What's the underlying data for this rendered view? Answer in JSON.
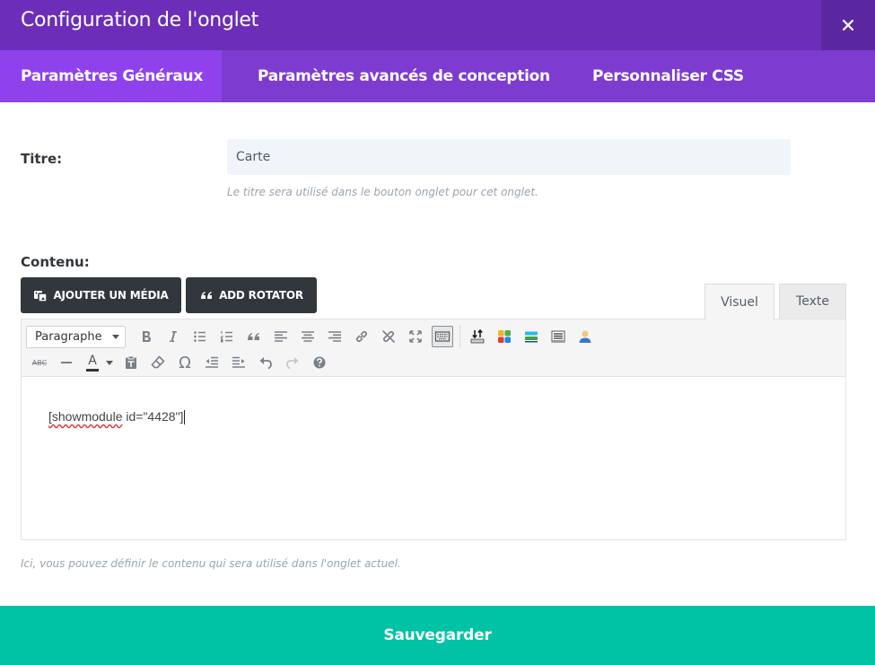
{
  "header": {
    "title": "Configuration de l'onglet",
    "close_icon": "close-icon",
    "bg_color": "#6c2eb9"
  },
  "tabs": [
    {
      "label": "Paramètres Généraux",
      "active": true
    },
    {
      "label": "Paramètres avancés de conception",
      "active": false
    },
    {
      "label": "Personnaliser CSS",
      "active": false
    }
  ],
  "title_field": {
    "label": "Titre:",
    "value": "Carte",
    "hint": "Le titre sera utilisé dans le bouton onglet pour cet onglet."
  },
  "content_field": {
    "label": "Contenu:",
    "hint": "Ici, vous pouvez définir le contenu qui sera utilisé dans l'onglet actuel.",
    "buttons": {
      "media": "AJOUTER UN MÉDIA",
      "rotator": "ADD ROTATOR"
    },
    "editor_tabs": {
      "visual": "Visuel",
      "text": "Texte",
      "active": "visual"
    },
    "toolbar": {
      "format_select": "Paragraphe",
      "row1_icons": [
        "bold-icon",
        "italic-icon",
        "bullet-list-icon",
        "numbered-list-icon",
        "blockquote-icon",
        "align-left-icon",
        "align-center-icon",
        "align-right-icon",
        "link-icon",
        "unlink-icon",
        "fullscreen-icon",
        "toolbar-toggle-icon",
        "upload-icon",
        "modules-icon",
        "layers-icon",
        "list-icon",
        "user-icon"
      ],
      "row2_icons": [
        "strikethrough-icon",
        "horizontal-line-icon",
        "text-color-icon",
        "paste-text-icon",
        "clear-format-icon",
        "special-char-icon",
        "outdent-icon",
        "indent-icon",
        "undo-icon",
        "redo-icon",
        "help-icon"
      ],
      "strikethrough_glyph": "ABC",
      "text_color_glyph": "A",
      "special_char_glyph": "Ω"
    },
    "editor_body": {
      "word_1": "[showmodule",
      "rest": " id=\"4428\"]"
    }
  },
  "save_button": {
    "label": "Sauvegarder",
    "color": "#00c3a5"
  }
}
